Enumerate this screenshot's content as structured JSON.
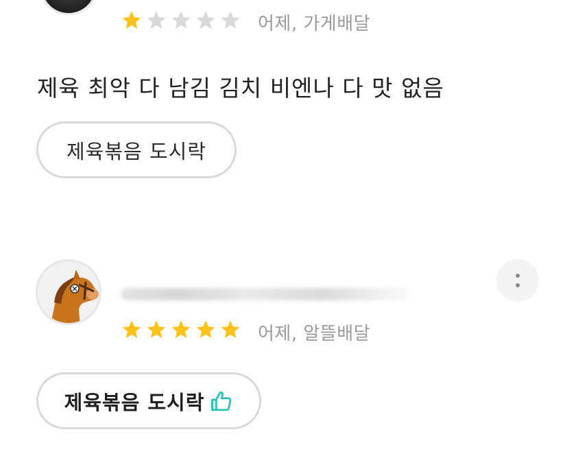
{
  "review1": {
    "rating": 1,
    "max_rating": 5,
    "meta": "어제, 가게배달",
    "text": "제육 최악 다 남김 김치 비엔나 다 맛 없음",
    "menu_chip": "제육볶음 도시락"
  },
  "review2": {
    "rating": 5,
    "max_rating": 5,
    "meta": "어제, 알뜰배달",
    "menu_chip": "제육볶음 도시락",
    "menu_chip_icon": "thumbs-up-icon"
  },
  "colors": {
    "star_filled": "#FFC21A",
    "star_empty": "#D9D9D9",
    "thumb_accent": "#2BC1B4"
  }
}
